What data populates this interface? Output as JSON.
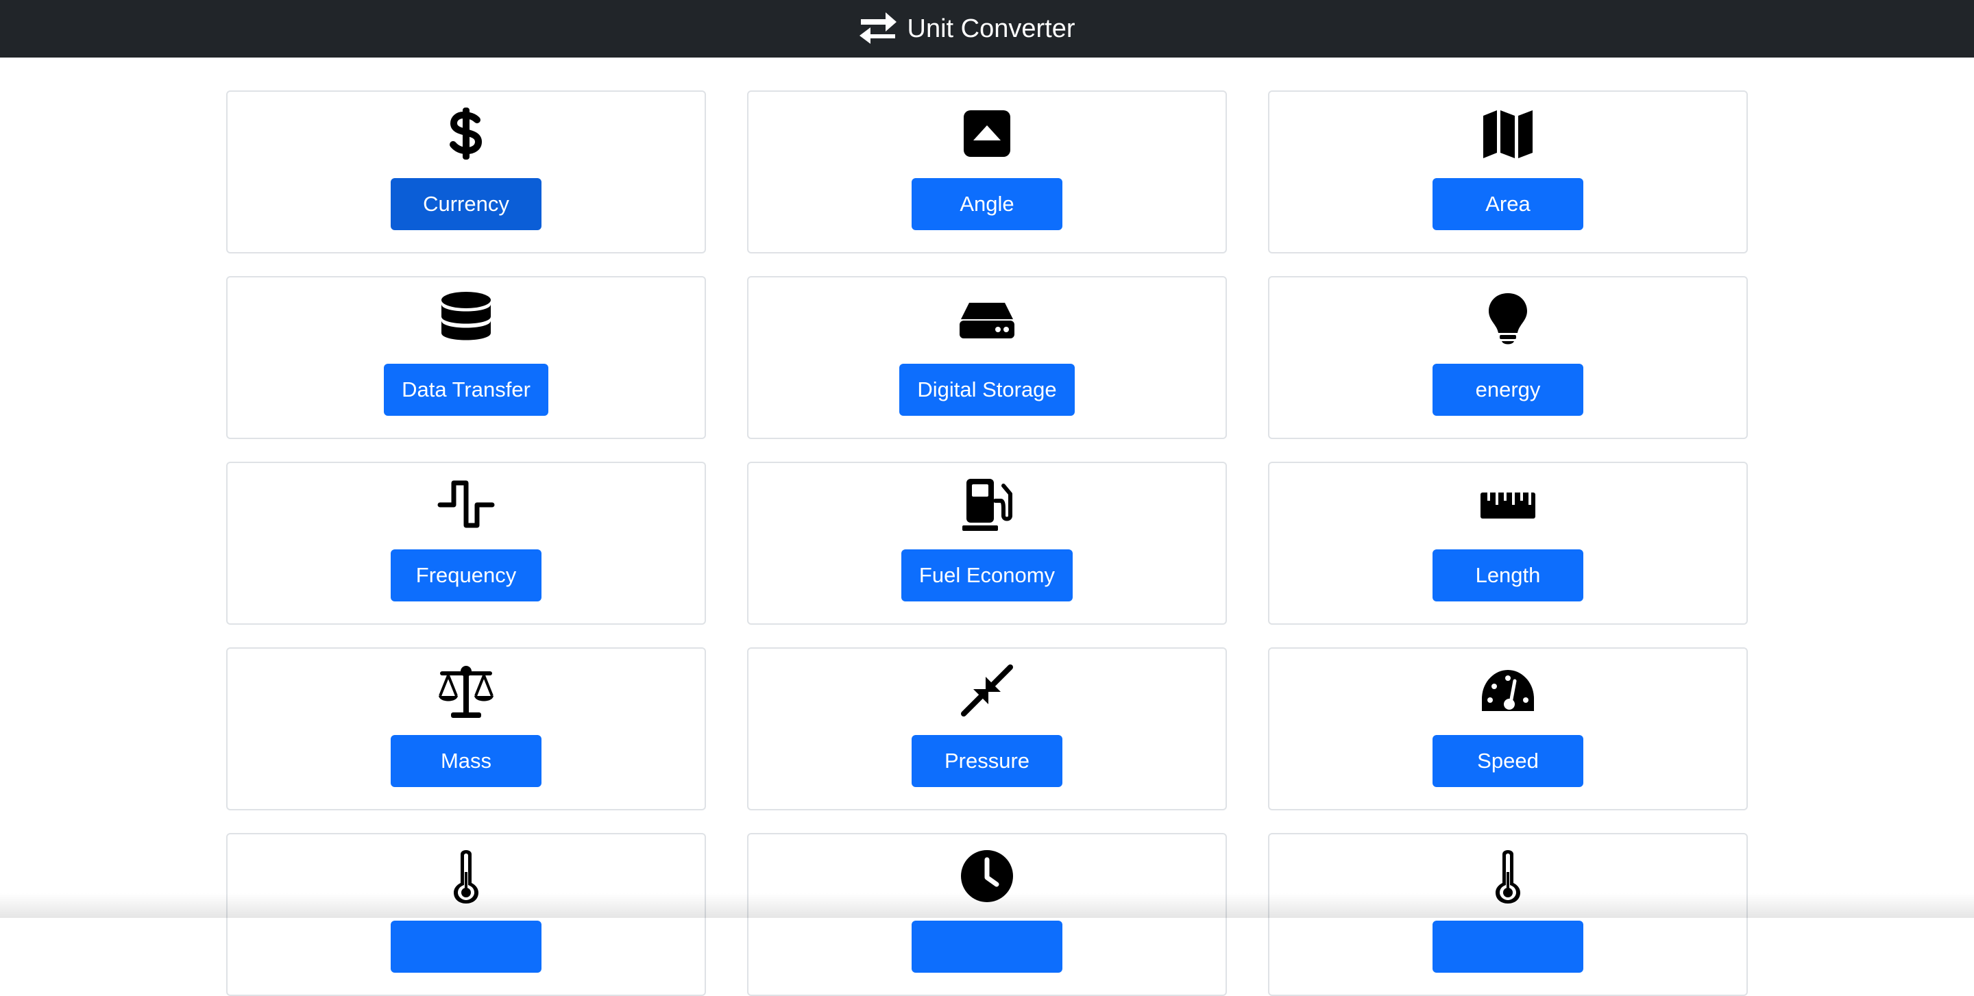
{
  "app": {
    "title": "Unit Converter",
    "brand_icon": "exchange-arrows-icon"
  },
  "colors": {
    "navbar": "#212529",
    "button": "#0d6efd",
    "button_active": "#0b5ed7",
    "card_border": "#dfe2e6"
  },
  "cards": [
    {
      "label": "Currency",
      "icon": "dollar-icon",
      "active": true
    },
    {
      "label": "Angle",
      "icon": "caret-up-square-icon"
    },
    {
      "label": "Area",
      "icon": "map-icon"
    },
    {
      "label": "Data Transfer",
      "icon": "database-icon"
    },
    {
      "label": "Digital Storage",
      "icon": "hard-drive-icon"
    },
    {
      "label": "energy",
      "icon": "lightbulb-icon"
    },
    {
      "label": "Frequency",
      "icon": "square-wave-icon"
    },
    {
      "label": "Fuel Economy",
      "icon": "fuel-pump-icon"
    },
    {
      "label": "Length",
      "icon": "ruler-icon"
    },
    {
      "label": "Mass",
      "icon": "scale-icon"
    },
    {
      "label": "Pressure",
      "icon": "compress-arrows-icon"
    },
    {
      "label": "Speed",
      "icon": "speedometer-icon"
    },
    {
      "label": "",
      "icon": "thermometer-icon"
    },
    {
      "label": "",
      "icon": "clock-icon"
    },
    {
      "label": "",
      "icon": "thermometer-icon"
    }
  ]
}
